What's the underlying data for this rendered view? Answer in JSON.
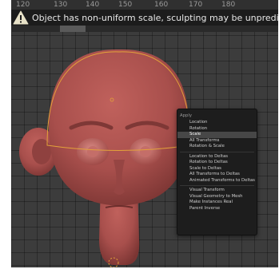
{
  "ruler": {
    "ticks": [
      "120",
      "130",
      "140",
      "150",
      "160",
      "170",
      "180"
    ]
  },
  "banner": {
    "icon": "warning-icon",
    "message": "Object has non-uniform scale, sculpting may be unpredictable"
  },
  "colors": {
    "clay": "#a84f4c",
    "outline": "#e3a23a",
    "menu_bg": "#1d1d1d",
    "highlight": "#474747"
  },
  "menu": {
    "title": "Apply",
    "groups": [
      [
        "Location",
        "Rotation",
        "Scale",
        "All Transforms",
        "Rotation & Scale"
      ],
      [
        "Location to Deltas",
        "Rotation to Deltas",
        "Scale to Deltas",
        "All Transforms to Deltas",
        "Animated Transforms to Deltas"
      ],
      [
        "Visual Transform",
        "Visual Geometry to Mesh",
        "Make Instances Real",
        "Parent Inverse"
      ]
    ],
    "active": "Scale"
  }
}
